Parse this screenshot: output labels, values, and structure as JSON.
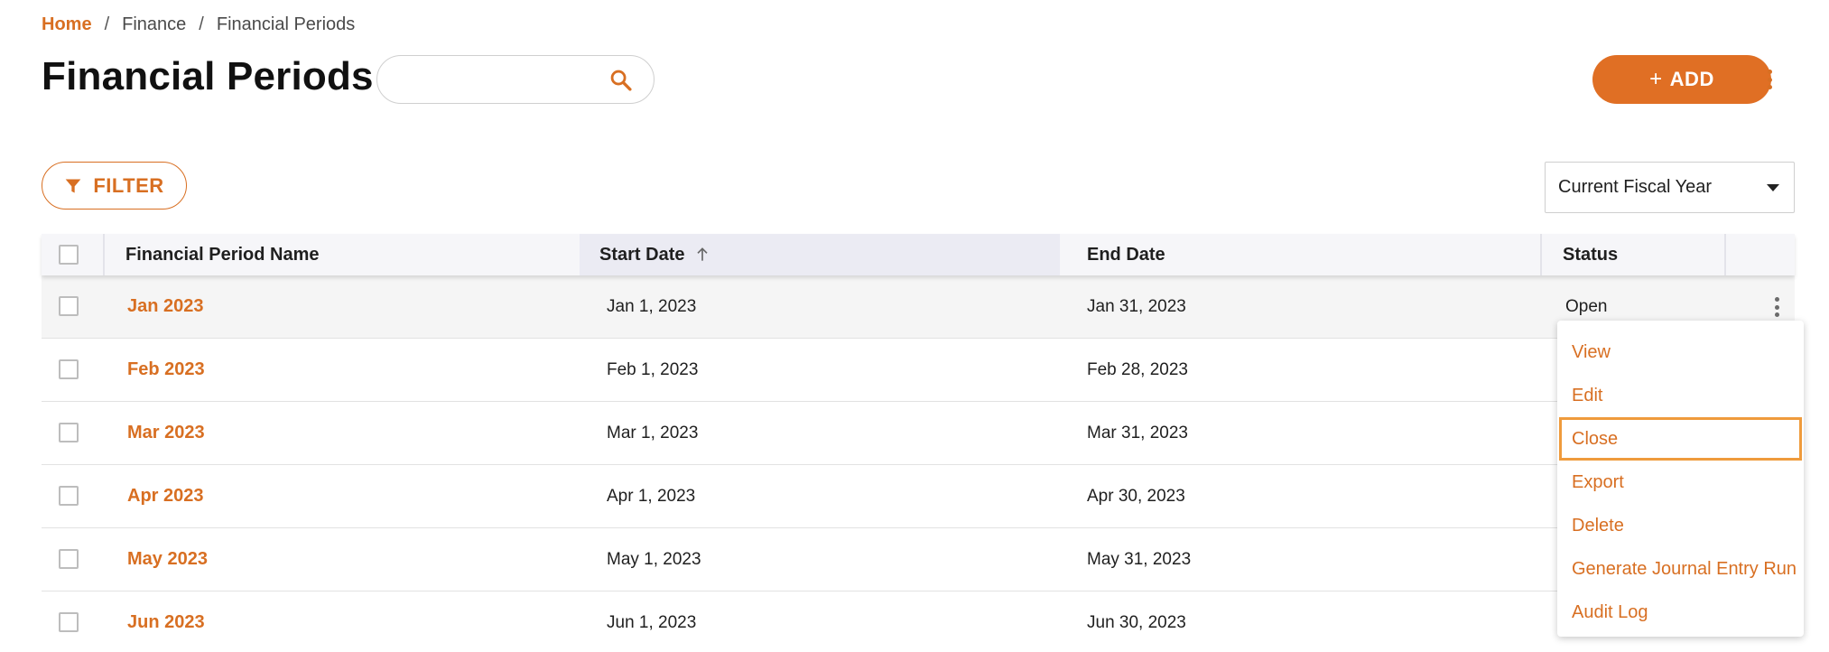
{
  "breadcrumb": {
    "home": "Home",
    "separator": "/",
    "finance": "Finance",
    "current": "Financial Periods"
  },
  "page": {
    "title": "Financial Periods"
  },
  "search": {
    "value": "",
    "placeholder": ""
  },
  "toolbar": {
    "add_plus": "+",
    "add_label": "ADD",
    "filter_label": "FILTER"
  },
  "fiscal_year_select": {
    "selected": "Current Fiscal Year"
  },
  "table": {
    "columns": {
      "name": "Financial Period Name",
      "start": "Start Date",
      "end": "End Date",
      "status": "Status"
    },
    "sort": {
      "column": "Start Date",
      "direction": "ascending"
    },
    "rows": [
      {
        "name": "Jan 2023",
        "start": "Jan 1, 2023",
        "end": "Jan 31, 2023",
        "status": "Open"
      },
      {
        "name": "Feb 2023",
        "start": "Feb 1, 2023",
        "end": "Feb 28, 2023",
        "status": ""
      },
      {
        "name": "Mar 2023",
        "start": "Mar 1, 2023",
        "end": "Mar 31, 2023",
        "status": ""
      },
      {
        "name": "Apr 2023",
        "start": "Apr 1, 2023",
        "end": "Apr 30, 2023",
        "status": ""
      },
      {
        "name": "May 2023",
        "start": "May 1, 2023",
        "end": "May 31, 2023",
        "status": ""
      },
      {
        "name": "Jun 2023",
        "start": "Jun 1, 2023",
        "end": "Jun 30, 2023",
        "status": ""
      }
    ]
  },
  "context_menu": {
    "items": [
      "View",
      "Edit",
      "Close",
      "Export",
      "Delete",
      "Generate Journal Entry Run",
      "Audit Log"
    ],
    "focused": "Close"
  },
  "colors": {
    "accent": "#e06f24",
    "link": "#d86f22",
    "focus_outline": "#ef9b3c"
  },
  "icons": {
    "search": "search-icon",
    "filter": "filter-icon",
    "sort": "arrow-up-icon",
    "more": "more-vertical-icon",
    "dropdown": "caret-down-icon"
  }
}
